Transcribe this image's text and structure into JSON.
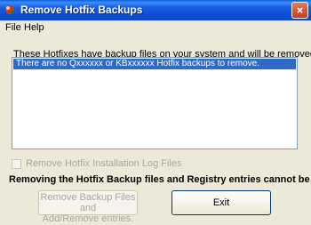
{
  "window": {
    "title": "Remove Hotfix Backups",
    "close_symbol": "×"
  },
  "menu": {
    "items": [
      {
        "label": "File"
      },
      {
        "label": "Help"
      }
    ]
  },
  "main": {
    "intro_text": "These Hotfixes have backup files on your system and will be removed.",
    "list_items": [
      {
        "text": "There are no Qxxxxxx or KBxxxxxx Hotfix backups to remove."
      }
    ],
    "checkbox": {
      "label": "Remove Hotfix Installation Log Files",
      "checked": false,
      "enabled": false
    },
    "warning_text": "Removing the Hotfix Backup files and Registry entries cannot be undone!"
  },
  "buttons": {
    "remove_line1": "Remove Backup Files and",
    "remove_line2": "Add/Remove  entries.",
    "exit_label": "Exit"
  },
  "colors": {
    "titlebar": "#0a4fd8",
    "selection": "#316ac5",
    "window_bg": "#ece9d8",
    "disabled_text": "#aca899"
  },
  "icons": {
    "app": "hotfix-app-icon",
    "close": "close-icon"
  }
}
